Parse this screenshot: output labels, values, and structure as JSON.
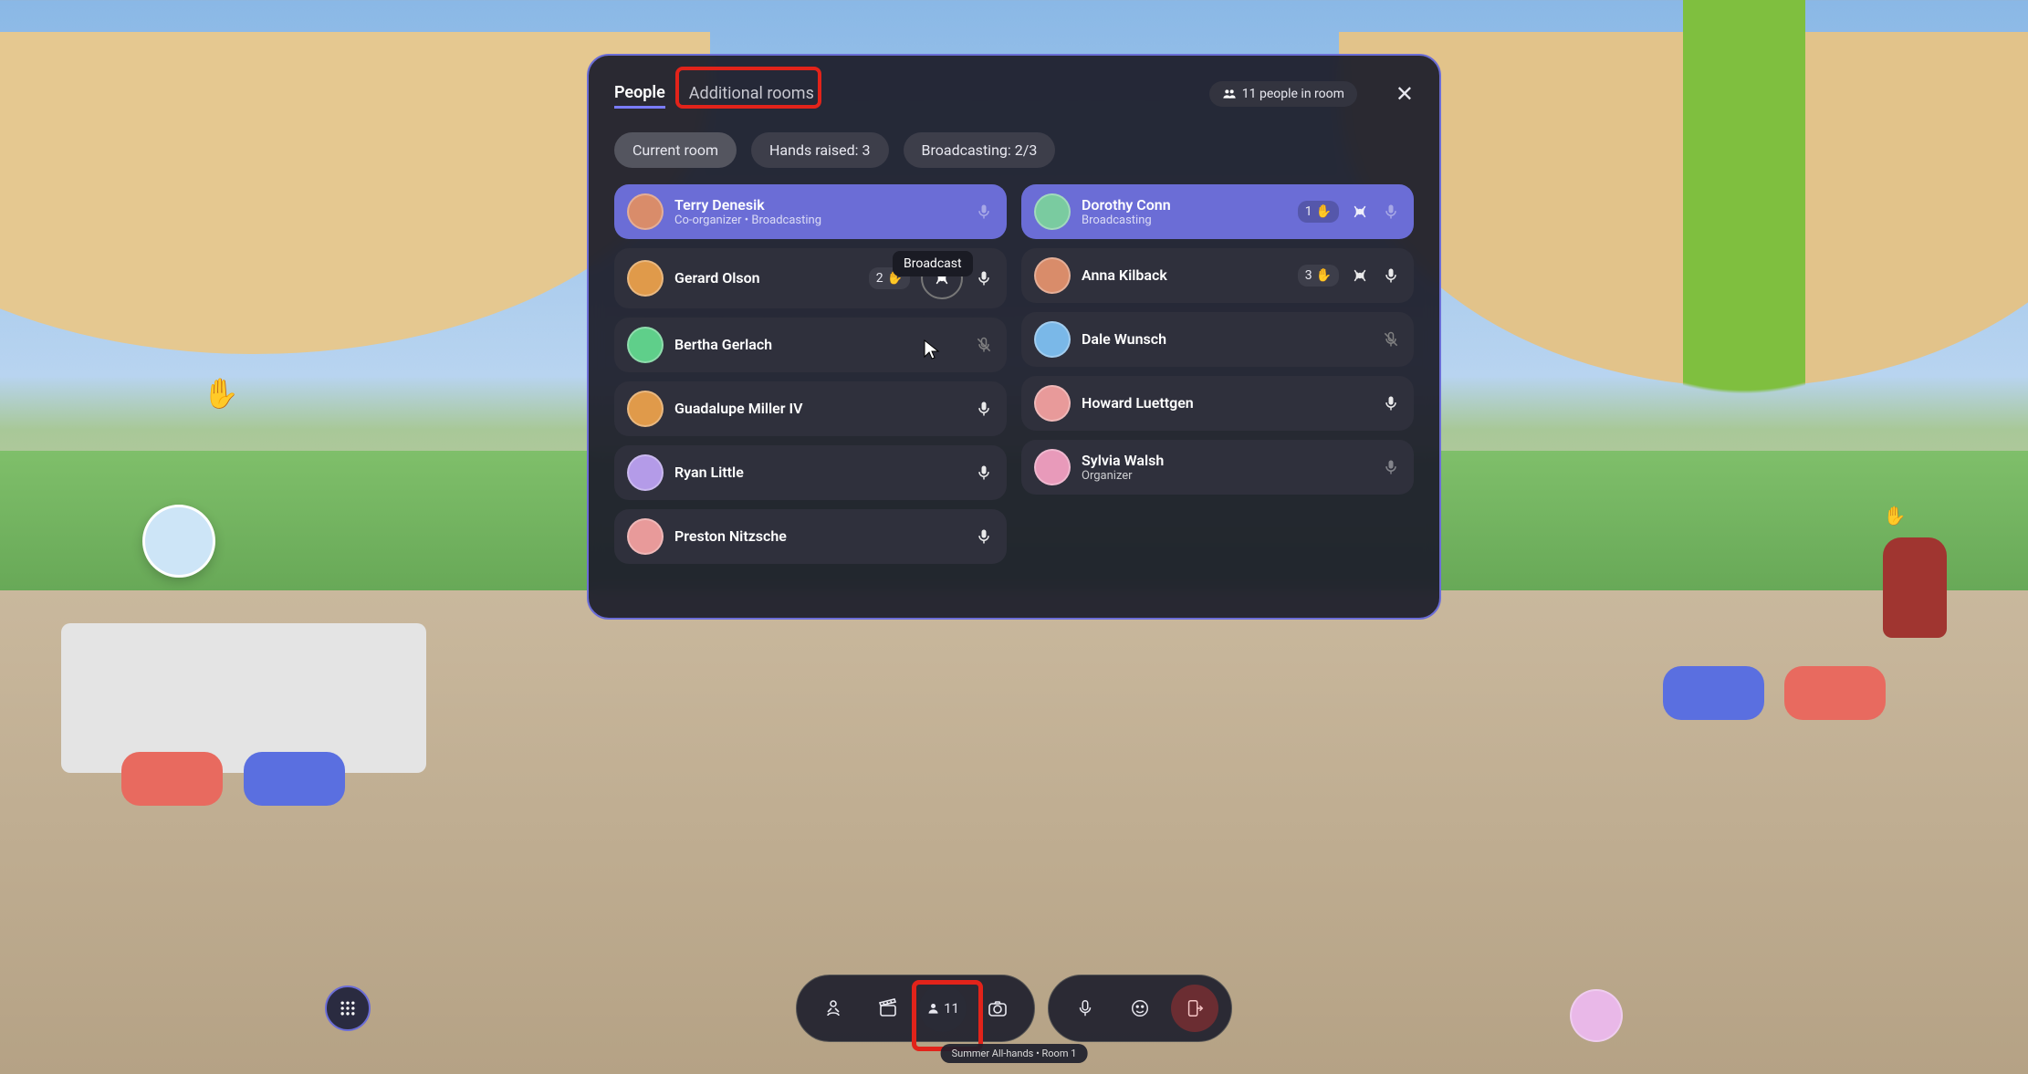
{
  "tabs": {
    "people": "People",
    "additional": "Additional rooms"
  },
  "room_badge": {
    "count": 11,
    "label": "11 people in room"
  },
  "chips": {
    "current": "Current room",
    "hands": "Hands raised: 3",
    "broadcasting": "Broadcasting: 2/3"
  },
  "tooltip_broadcast": "Broadcast",
  "left": [
    {
      "name": "Terry Denesik",
      "sub": "Co-organizer • Broadcasting",
      "hl": true,
      "avatar": "#d98c6a",
      "mic": "dim"
    },
    {
      "name": "Gerard Olson",
      "hand": "2",
      "avatar": "#e09a4a",
      "broadcast_btn": true,
      "mic": "on"
    },
    {
      "name": "Bertha Gerlach",
      "avatar": "#5fcf8a",
      "mic": "off"
    },
    {
      "name": "Guadalupe Miller IV",
      "avatar": "#e09a4a",
      "mic": "on"
    },
    {
      "name": "Ryan Little",
      "avatar": "#b49be8",
      "mic": "on"
    },
    {
      "name": "Preston Nitzsche",
      "avatar": "#e89a9a",
      "mic": "on"
    }
  ],
  "right": [
    {
      "name": "Dorothy Conn",
      "sub": "Broadcasting",
      "hl": true,
      "avatar": "#7acba0",
      "hand": "1",
      "broadcast": true,
      "mic": "dim"
    },
    {
      "name": "Anna Kilback",
      "avatar": "#d98c6a",
      "hand": "3",
      "broadcast": true,
      "mic": "on"
    },
    {
      "name": "Dale Wunsch",
      "avatar": "#7ab8e8",
      "mic": "off"
    },
    {
      "name": "Howard Luettgen",
      "avatar": "#e89a9a",
      "mic": "on"
    },
    {
      "name": "Sylvia Walsh",
      "sub": "Organizer",
      "avatar": "#e89aba",
      "mic": "dim"
    }
  ],
  "dock": {
    "people_count": "11"
  },
  "room_label": "Summer All-hands • Room 1"
}
